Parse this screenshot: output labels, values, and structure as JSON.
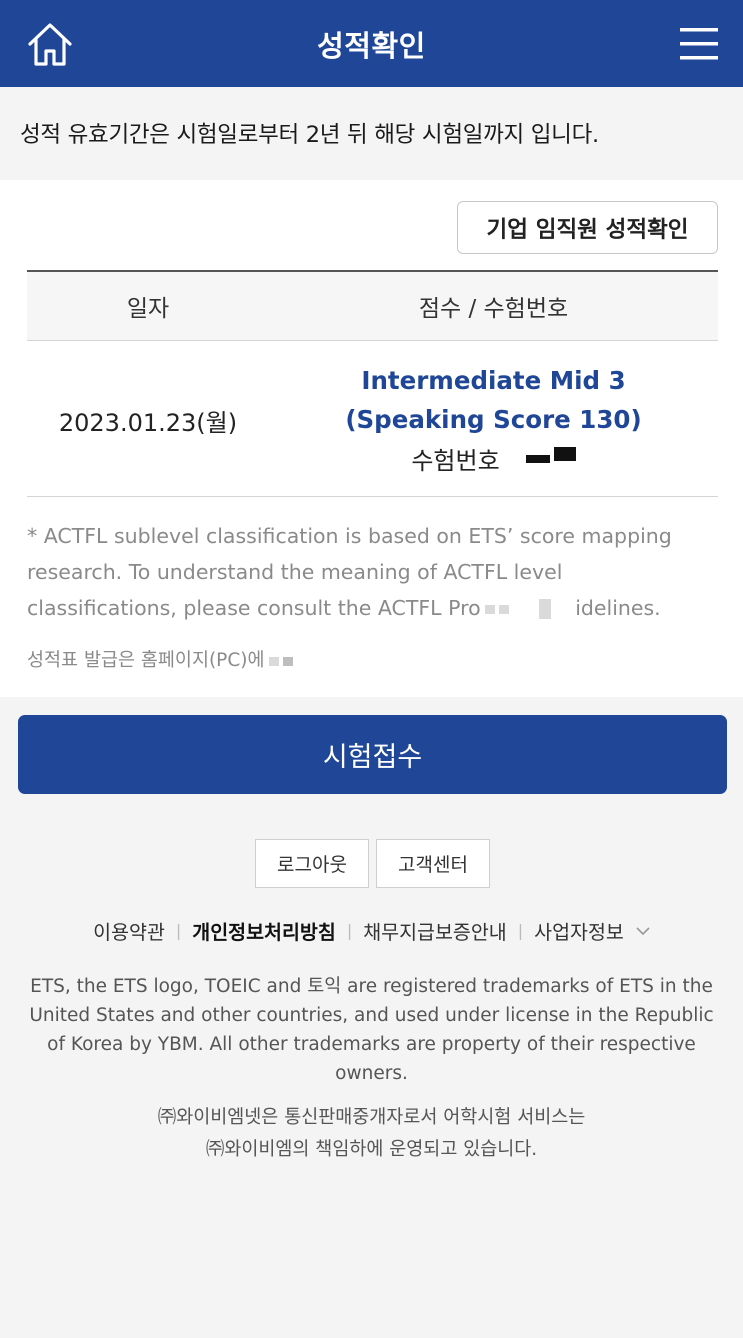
{
  "header": {
    "title": "성적확인",
    "home_icon": "home-icon",
    "menu_icon": "hamburger-menu-icon",
    "color": "#1f4697"
  },
  "notice": "성적 유효기간은 시험일로부터 2년 뒤 해당 시험일까지 입니다.",
  "corp_button": "기업 임직원 성적확인",
  "table": {
    "headers": [
      "일자",
      "점수 / 수험번호"
    ],
    "rows": [
      {
        "date": "2023.01.23(월)",
        "score": "Intermediate Mid 3 (Speaking Score 130)",
        "exam_number_label": "수험번호"
      }
    ]
  },
  "footnote": "* ACTFL sublevel classification is based on ETS’ score mapping research. To understand the meaning of ACTFL level classifications, please consult the ACTFL Pro",
  "footnote_tail": "idelines.",
  "issue_note": "성적표 발급은 홈페이지(PC)에",
  "apply_button": "시험접수",
  "small_buttons": [
    "로그아웃",
    "고객센터"
  ],
  "footer_links": [
    {
      "label": "이용약관",
      "bold": false
    },
    {
      "label": "개인정보처리방침",
      "bold": true
    },
    {
      "label": "채무지급보증안내",
      "bold": false
    },
    {
      "label": "사업자정보",
      "bold": false
    }
  ],
  "trademark": "ETS, the ETS logo, TOEIC and 토익 are registered trademarks of ETS in the United States and other countries, and used under license in the Republic of Korea by YBM. All other trademarks are property of their respective owners.",
  "company_line1": "㈜와이비엠넷은 통신판매중개자로서 어학시험 서비스는",
  "company_line2": "㈜와이비엠의 책임하에 운영되고 있습니다."
}
